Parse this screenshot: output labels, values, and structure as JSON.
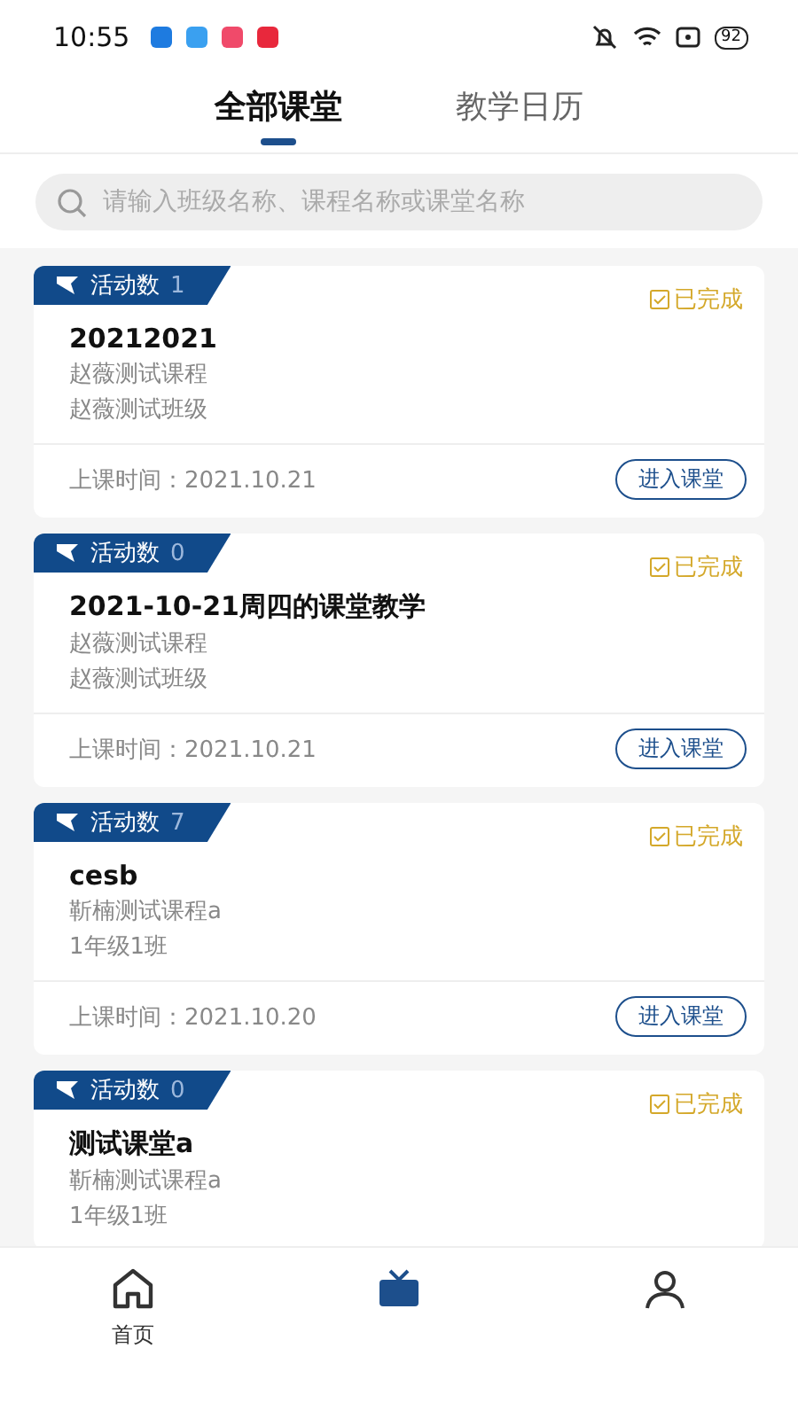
{
  "status_bar": {
    "time": "10:55",
    "battery": "92"
  },
  "tabs": [
    {
      "label": "全部课堂",
      "selected": true
    },
    {
      "label": "教学日历",
      "selected": false
    }
  ],
  "search": {
    "placeholder": "请输入班级名称、课程名称或课堂名称"
  },
  "classes": [
    {
      "activity_label": "活动数",
      "activity_count": "1",
      "status": "已完成",
      "title": "20212021",
      "course": "赵薇测试课程",
      "class_name": "赵薇测试班级",
      "time": "上课时间：2021.10.21",
      "button": "进入课堂"
    },
    {
      "activity_label": "活动数",
      "activity_count": "0",
      "status": "已完成",
      "title": "2021-10-21周四的课堂教学",
      "course": "赵薇测试课程",
      "class_name": "赵薇测试班级",
      "time": "上课时间：2021.10.21",
      "button": "进入课堂"
    },
    {
      "activity_label": "活动数",
      "activity_count": "7",
      "status": "已完成",
      "title": "cesb",
      "course": "靳楠测试课程a",
      "class_name": "1年级1班",
      "time": "上课时间：2021.10.20",
      "button": "进入课堂"
    },
    {
      "activity_label": "活动数",
      "activity_count": "0",
      "status": "已完成",
      "title": "测试课堂a",
      "course": "靳楠测试课程a",
      "class_name": "1年级1班"
    }
  ],
  "bottom_nav": [
    {
      "kind": "home",
      "label": "首页",
      "selected": false
    },
    {
      "kind": "classroom",
      "selected": true
    },
    {
      "kind": "profile",
      "selected": false
    }
  ]
}
